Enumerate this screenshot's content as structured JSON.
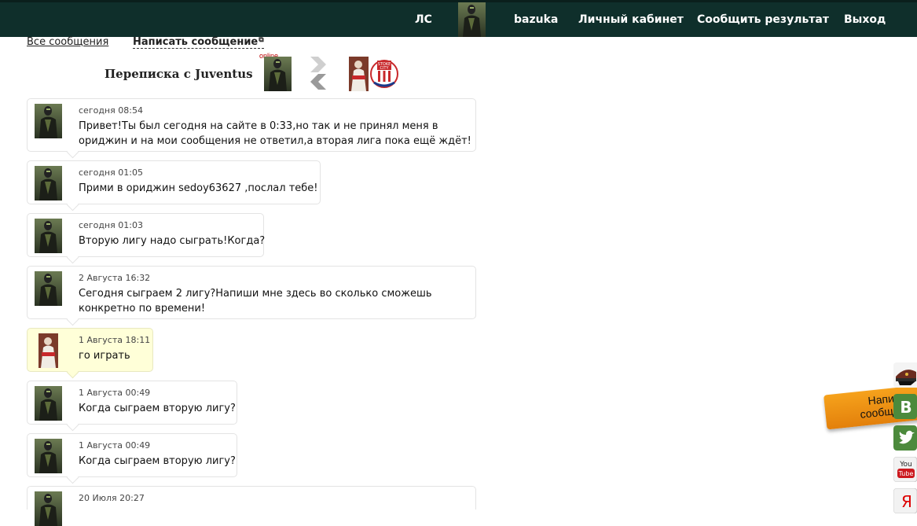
{
  "nav": {
    "ls": "ЛС",
    "username": "bazuka",
    "cabinet": "Личный кабинет",
    "report": "Сообщить результат",
    "logout": "Выход"
  },
  "subnav": {
    "all_messages": "Все сообщения",
    "write_message": "Написать сообщение",
    "external_icon": "⧉"
  },
  "conversation": {
    "title": "Переписка с Juventus",
    "online_label": "online"
  },
  "messages": [
    {
      "date": "сегодня 08:54",
      "text": "Привет!Ты был сегодня на сайте в 0:33,но так и не принял меня в ориджин и на мои сообщения не ответил,а вторая лига пока ещё ждёт!",
      "from": "juventus"
    },
    {
      "date": "сегодня 01:05",
      "text": "Прими в ориджин sedoy63627 ,послал тебе!",
      "from": "juventus"
    },
    {
      "date": "сегодня 01:03",
      "text": "Вторую лигу надо сыграть!Когда?",
      "from": "juventus"
    },
    {
      "date": "2 Августа 16:32",
      "text": "Сегодня сыграем 2 лигу?Напиши мне здесь во сколько сможешь конкретно по времени!",
      "from": "juventus"
    },
    {
      "date": "1 Августа 18:11",
      "text": "го играть",
      "from": "me"
    },
    {
      "date": "1 Августа 00:49",
      "text": "Когда сыграем вторую лигу?",
      "from": "juventus"
    },
    {
      "date": "1 Августа 00:49",
      "text": "Когда сыграем вторую лигу?",
      "from": "juventus"
    },
    {
      "date": "20 Июля 20:27",
      "text": "",
      "from": "juventus"
    }
  ],
  "side_widget": {
    "write_label": "Написать сообщение"
  },
  "social": [
    {
      "icon": "officer-cap-icon"
    },
    {
      "icon": "vk-icon",
      "label": "В"
    },
    {
      "icon": "twitter-icon"
    },
    {
      "icon": "youtube-icon",
      "label": "You Tube"
    },
    {
      "icon": "yandex-icon",
      "label": "Я"
    }
  ],
  "colors": {
    "topbar": "#0f2f2b",
    "my_message_bg": "#ffffd8",
    "orange_tab": "#f29a1a",
    "vk_green": "#4c8a3c",
    "youtube_red": "#cc181e"
  }
}
